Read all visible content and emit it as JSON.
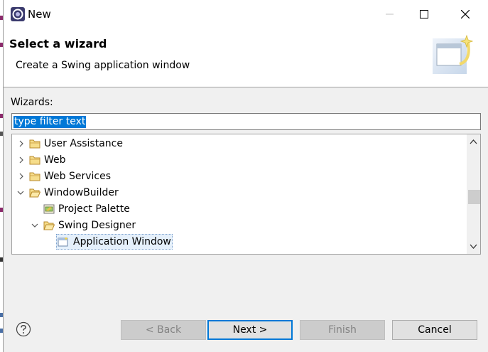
{
  "window": {
    "title": "New"
  },
  "header": {
    "title": "Select a wizard",
    "description": "Create a Swing application window"
  },
  "wizards_label": "Wizards:",
  "filter": {
    "value": "type filter text"
  },
  "tree": {
    "items": [
      {
        "label": "User Assistance",
        "expanded": false,
        "icon": "folder-icon"
      },
      {
        "label": "Web",
        "expanded": false,
        "icon": "folder-icon"
      },
      {
        "label": "Web Services",
        "expanded": false,
        "icon": "folder-icon"
      },
      {
        "label": "WindowBuilder",
        "expanded": true,
        "icon": "folder-icon"
      },
      {
        "label": "Project Palette",
        "icon": "palette-icon"
      },
      {
        "label": "Swing Designer",
        "expanded": true,
        "icon": "folder-icon"
      },
      {
        "label": "Application Window",
        "selected": true,
        "icon": "new-window-icon"
      }
    ]
  },
  "buttons": {
    "back": "< Back",
    "next": "Next >",
    "finish": "Finish",
    "cancel": "Cancel"
  },
  "colors": {
    "selection": "#0078d7",
    "folder": "#dcb35c",
    "dialog_bg": "#f0f0f0"
  }
}
